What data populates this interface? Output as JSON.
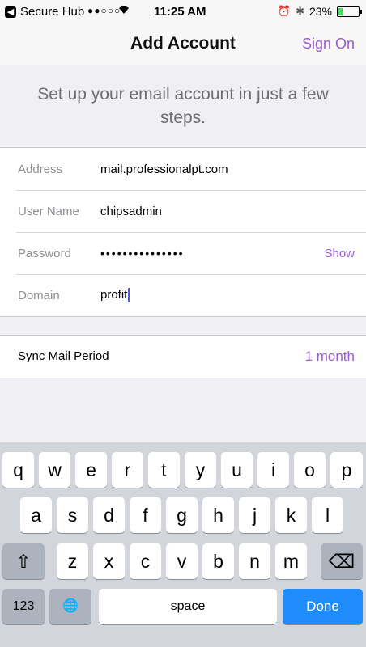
{
  "status_bar": {
    "back_app": "Secure Hub",
    "signal": "●●○○○",
    "time": "11:25 AM",
    "battery": "23%"
  },
  "nav": {
    "title": "Add Account",
    "sign_on": "Sign On"
  },
  "intro": "Set up your email account in just a few steps.",
  "fields": [
    {
      "label": "Address",
      "value": "mail.professionalpt.com"
    },
    {
      "label": "User Name",
      "value": "chipsadmin"
    },
    {
      "label": "Password",
      "value": "•••••••••••••••",
      "action": "Show"
    },
    {
      "label": "Domain",
      "value": "profit"
    }
  ],
  "sync": {
    "label": "Sync Mail Period",
    "value": "1 month"
  },
  "keyboard": {
    "row1": [
      "q",
      "w",
      "e",
      "r",
      "t",
      "y",
      "u",
      "i",
      "o",
      "p"
    ],
    "row2": [
      "a",
      "s",
      "d",
      "f",
      "g",
      "h",
      "j",
      "k",
      "l"
    ],
    "row3": [
      "z",
      "x",
      "c",
      "v",
      "b",
      "n",
      "m"
    ],
    "shift_icon": "⇧",
    "delete_icon": "⌫",
    "numbers_label": "123",
    "globe_icon": "🌐",
    "space_label": "space",
    "done_label": "Done"
  },
  "colors": {
    "accent": "#9b59d0",
    "done_blue": "#1e8cfb"
  }
}
